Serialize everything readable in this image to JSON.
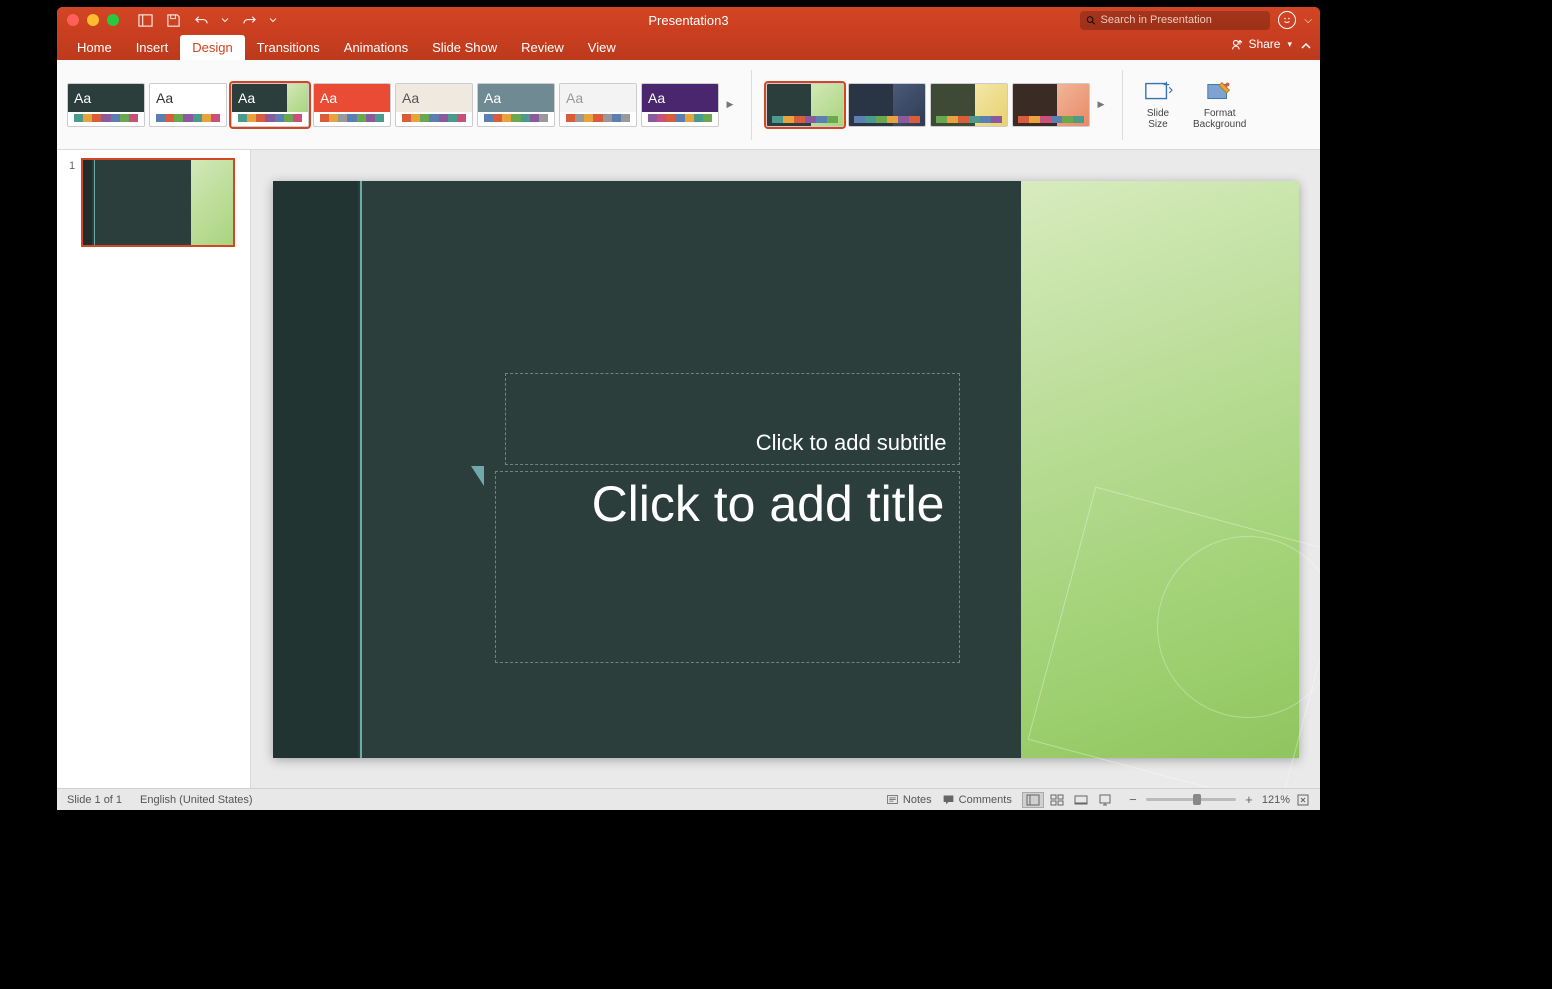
{
  "title": "Presentation3",
  "search_placeholder": "Search in Presentation",
  "share_label": "Share",
  "tabs": [
    "Home",
    "Insert",
    "Design",
    "Transitions",
    "Animations",
    "Slide Show",
    "Review",
    "View"
  ],
  "active_tab": "Design",
  "tools": {
    "slideSize": "Slide\nSize",
    "formatBg": "Format\nBackground"
  },
  "thumb_number": "1",
  "slide": {
    "subtitle_placeholder": "Click to add subtitle",
    "title_placeholder": "Click to add title"
  },
  "status": {
    "slide_info": "Slide 1 of 1",
    "language": "English (United States)",
    "notes": "Notes",
    "comments": "Comments",
    "zoom_pct": "121%"
  }
}
